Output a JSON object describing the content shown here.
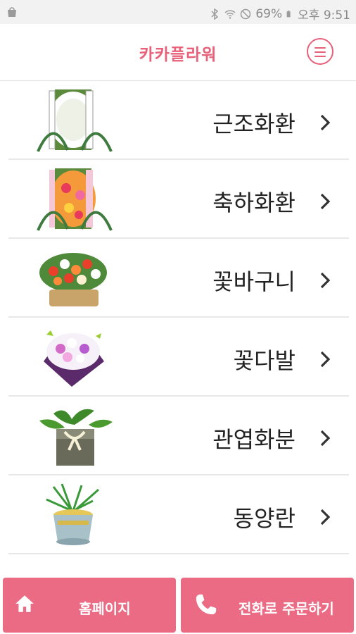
{
  "status_bar": {
    "battery": "69%",
    "time": "오후 9:51",
    "icons": [
      "shopping-bag-icon",
      "bluetooth-icon",
      "wifi-icon",
      "do-not-disturb-icon",
      "battery-icon"
    ]
  },
  "header": {
    "title": "카카플라워",
    "menu_icon": "hamburger-menu-icon",
    "accent_color": "#e8607a"
  },
  "categories": [
    {
      "label": "근조화환",
      "image": "funeral-wreath"
    },
    {
      "label": "축하화환",
      "image": "celebration-wreath"
    },
    {
      "label": "꽃바구니",
      "image": "flower-basket"
    },
    {
      "label": "꽃다발",
      "image": "flower-bouquet"
    },
    {
      "label": "관엽화분",
      "image": "foliage-plant-pot"
    },
    {
      "label": "동양란",
      "image": "oriental-orchid"
    }
  ],
  "bottom_bar": {
    "home_label": "홈페이지",
    "call_label": "전화로 주문하기",
    "button_color": "#eb6b84"
  }
}
